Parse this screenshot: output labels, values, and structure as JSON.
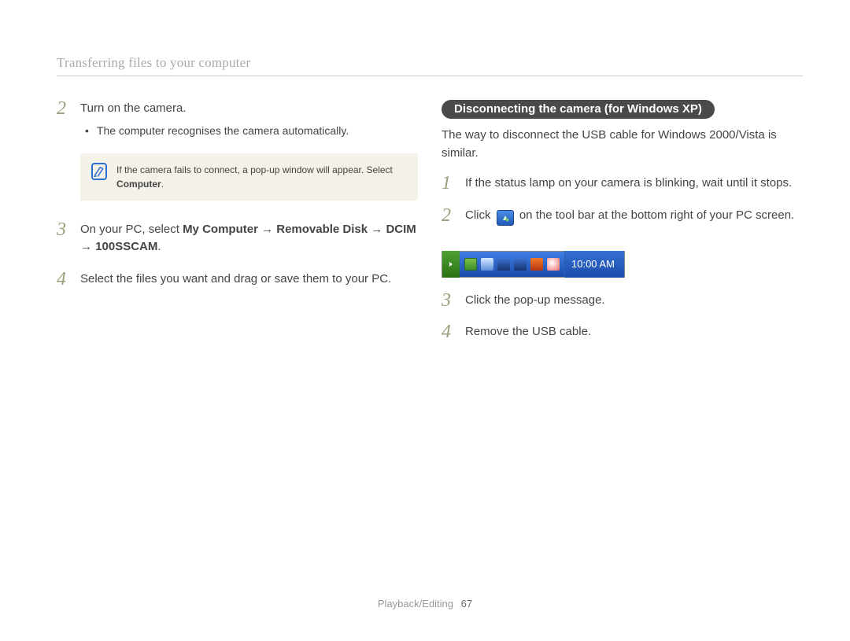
{
  "section_title": "Transferring files to your computer",
  "left": {
    "step2": {
      "num": "2",
      "text": "Turn on the camera.",
      "bullet": "The computer recognises the camera automatically."
    },
    "note": {
      "text_pre": "If the camera fails to connect, a pop-up window will appear. Select ",
      "text_bold": "Computer",
      "text_post": "."
    },
    "step3": {
      "num": "3",
      "pre": "On your PC, select ",
      "bold": "My Computer → Removable Disk → DCIM → 100SSCAM",
      "post": "."
    },
    "step4": {
      "num": "4",
      "text": "Select the files you want and drag or save them to your PC."
    }
  },
  "right": {
    "badge": "Disconnecting the camera (for Windows XP)",
    "intro": "The way to disconnect the USB cable for Windows 2000/Vista is similar.",
    "step1": {
      "num": "1",
      "text": "If the status lamp on your camera is blinking, wait until it stops."
    },
    "step2": {
      "num": "2",
      "pre": "Click ",
      "post": " on the tool bar at the bottom right of your PC screen."
    },
    "taskbar_clock": "10:00 AM",
    "step3": {
      "num": "3",
      "text": "Click the pop-up message."
    },
    "step4": {
      "num": "4",
      "text": "Remove the USB cable."
    }
  },
  "footer": {
    "section": "Playback/Editing",
    "page": "67"
  }
}
